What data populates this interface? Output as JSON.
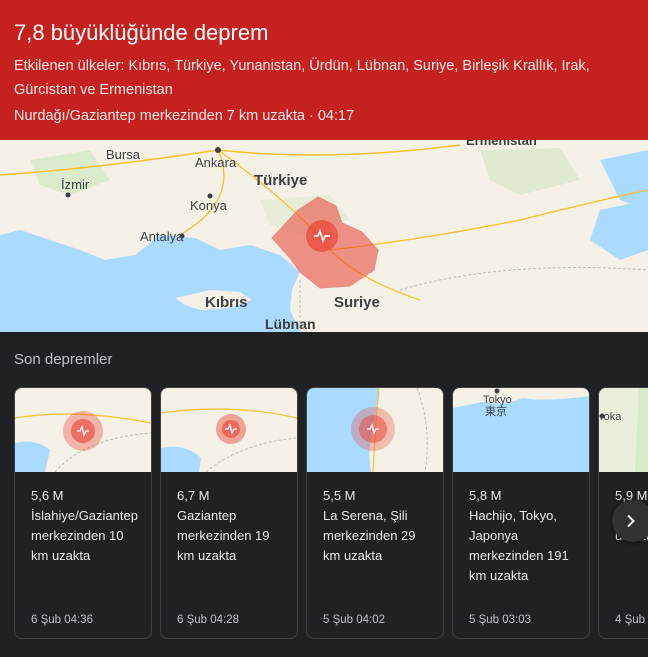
{
  "header": {
    "title": "7,8 büyüklüğünde deprem",
    "affected": "Etkilenen ülkeler: Kıbrıs, Türkiye, Yunanistan, Ürdün, Lübnan, Suriye, Birleşik Krallık, Irak, Gürcistan ve Ermenistan",
    "location": "Nurdağı/Gaziantep merkezinden 7 km uzakta · 04:17",
    "color": "#c5221f"
  },
  "map": {
    "labels": {
      "bursa": "Bursa",
      "ankara": "Ankara",
      "izmir": "İzmir",
      "turkiye": "Türkiye",
      "konya": "Konya",
      "antalya": "Antalya",
      "kibris": "Kıbrıs",
      "suriye": "Suriye",
      "lubnan": "Lübnan",
      "ermenistan": "Ermenistan"
    },
    "epicenter_icon": "seismograph-icon",
    "zone_color": "#ea4335"
  },
  "recent": {
    "title": "Son depremler",
    "cards": [
      {
        "mag": "5,6 M",
        "desc": "İslahiye/Gaziantep merkezinden 10 km uzakta",
        "time": "6 Şub 04:36"
      },
      {
        "mag": "6,7 M",
        "desc": "Gaziantep merkezinden 19 km uzakta",
        "time": "6 Şub 04:28"
      },
      {
        "mag": "5,5 M",
        "desc": "La Serena, Şili merkezinden 29 km uzakta",
        "time": "5 Şub 04:02"
      },
      {
        "mag": "5,8 M",
        "desc": "Hachijo, Tokyo, Japonya merkezinden 191 km uzakta",
        "time": "5 Şub 03:03",
        "map_label_en": "Tokyo",
        "map_label_jp": "東京"
      },
      {
        "mag": "5,9 M",
        "desc": "Kaza Yeni C km uzakta",
        "time": "4 Şub",
        "map_label": "roka"
      }
    ],
    "next_icon": "chevron-right-icon"
  }
}
